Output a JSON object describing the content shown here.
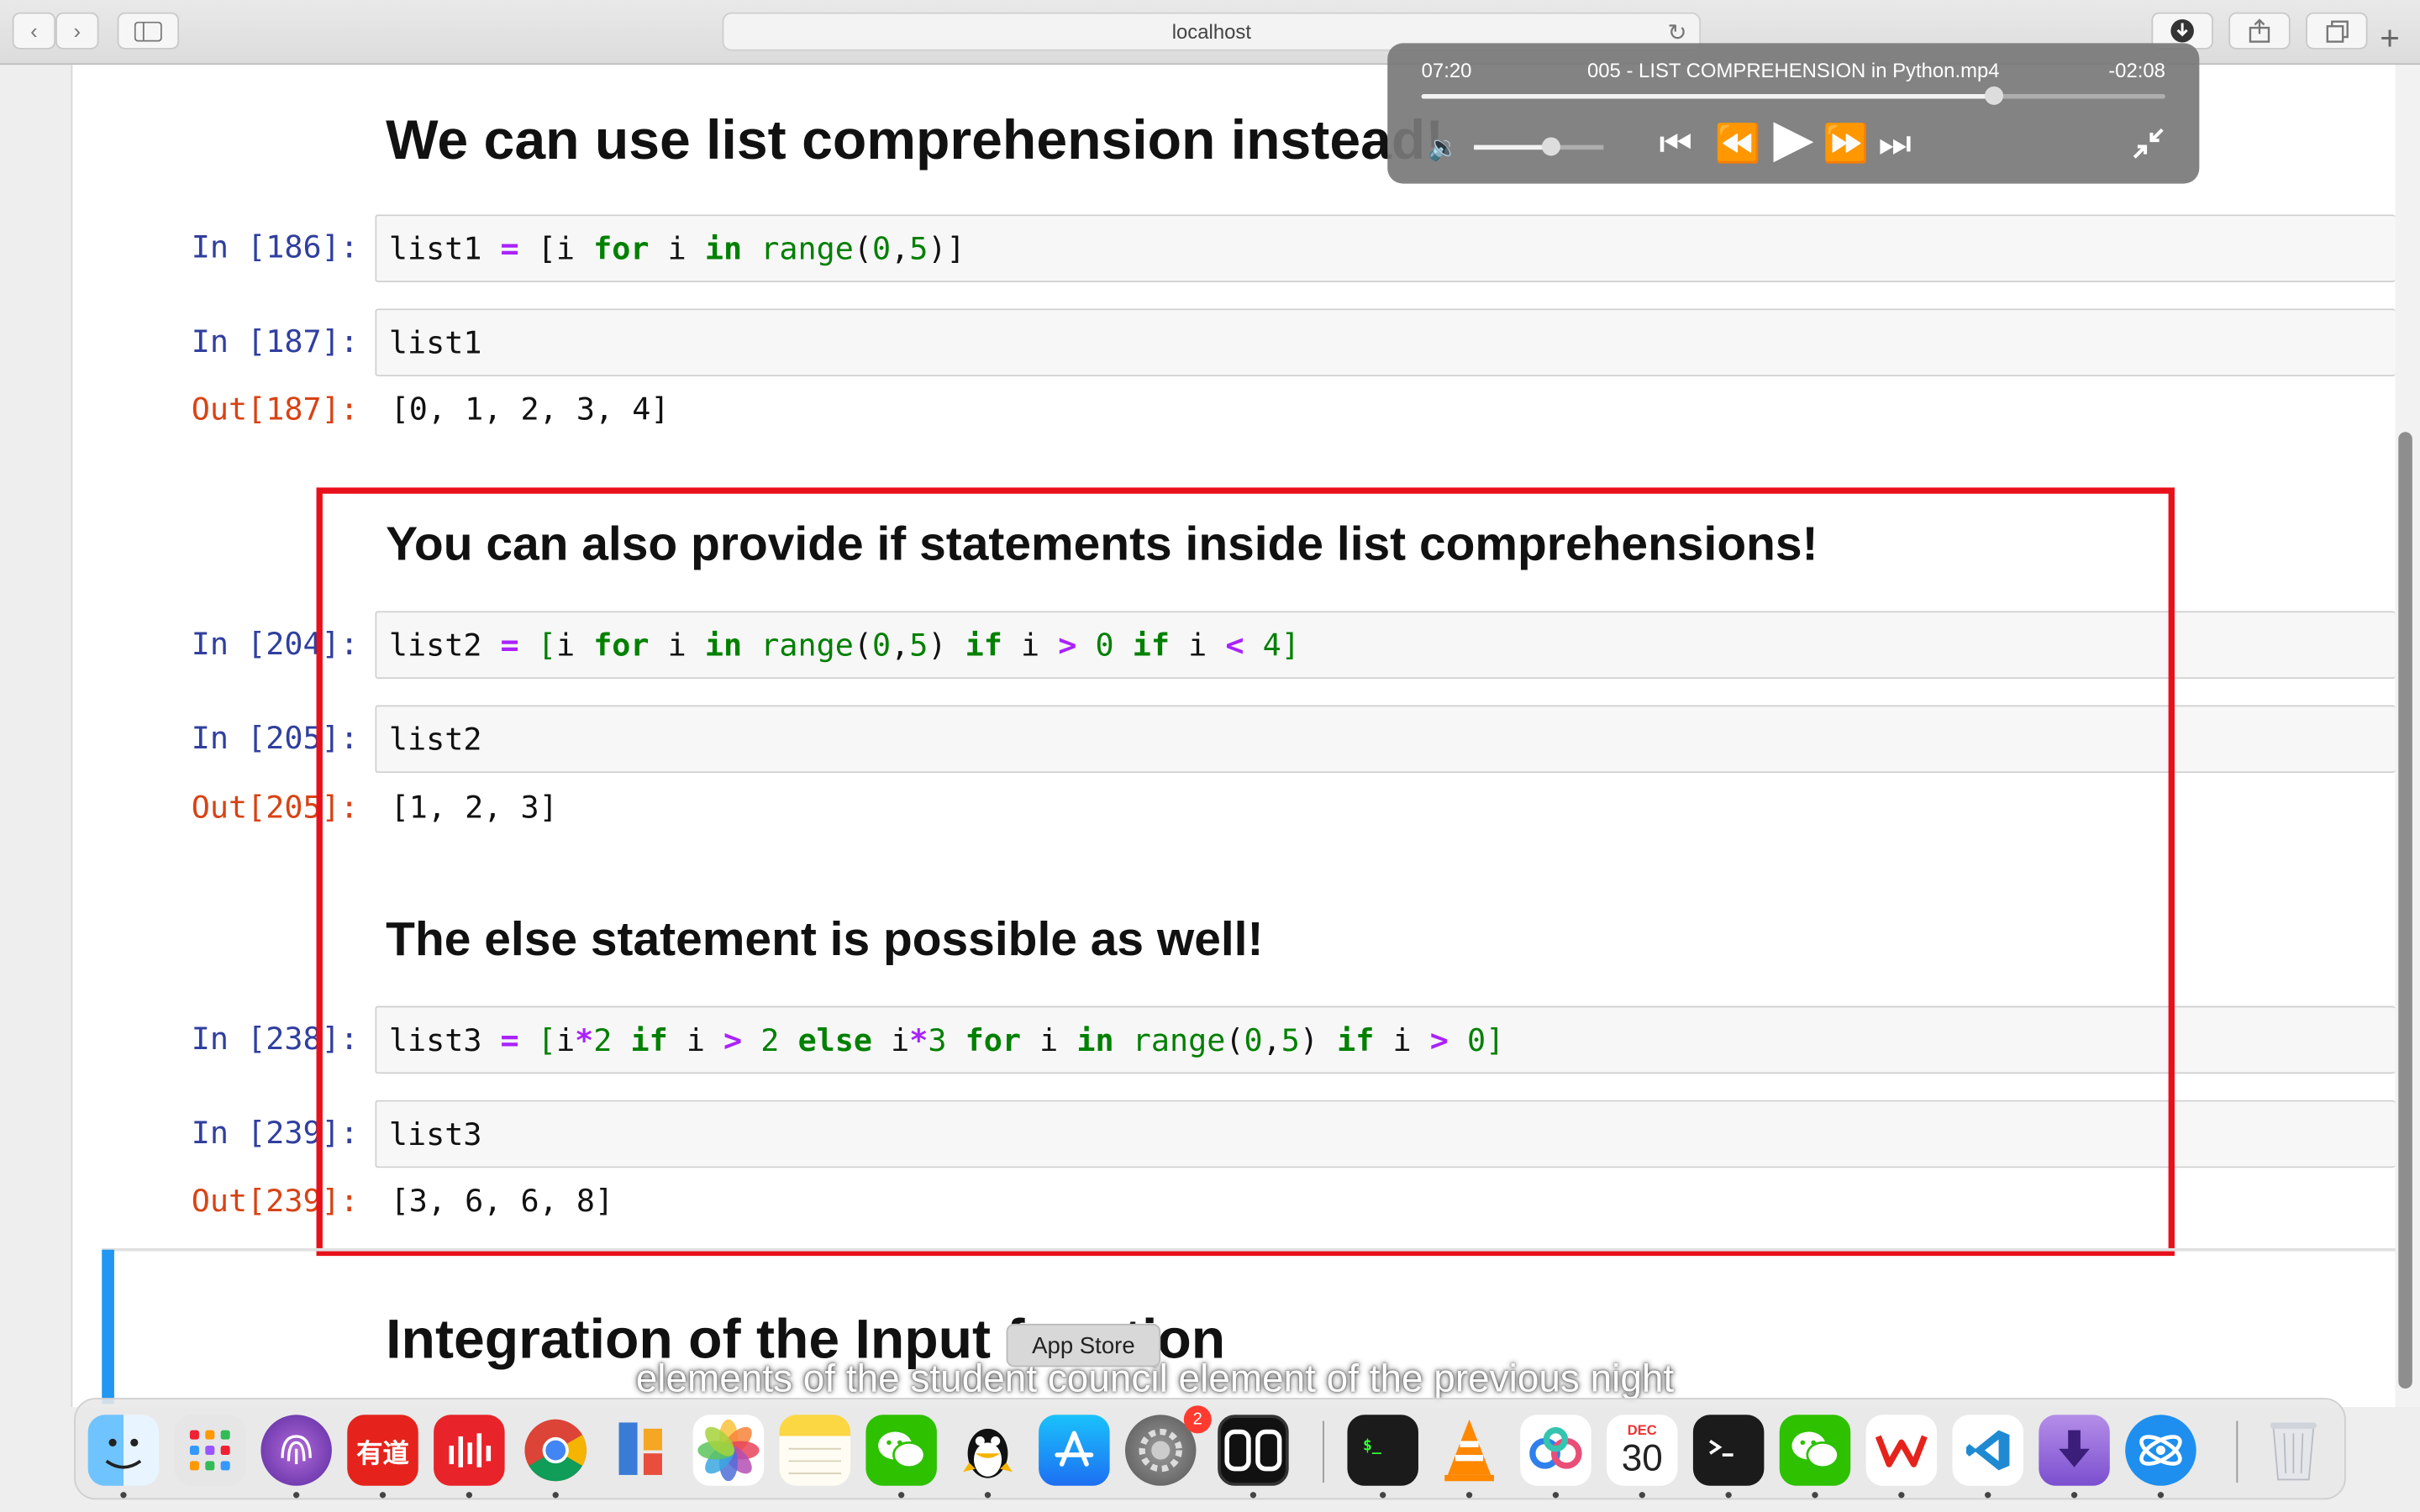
{
  "browser": {
    "address": "localhost",
    "back_icon": "chevron-left-icon",
    "forward_icon": "chevron-right-icon",
    "sidebar_icon": "sidebar-icon",
    "reload_icon": "reload-icon",
    "new_tab_label": "+"
  },
  "notebook": {
    "headings": {
      "h1": "We can use list comprehension instead!",
      "h2": "You can also provide if statements inside list comprehensions!",
      "h3": "The else statement is possible as well!",
      "h4": "Integration of the Input function"
    },
    "prompts": {
      "p186": "In [186]:",
      "p187": "In [187]:",
      "o187": "Out[187]:",
      "p204": "In [204]:",
      "p205": "In [205]:",
      "o205": "Out[205]:",
      "p238": "In [238]:",
      "p239": "In [239]:",
      "o239": "Out[239]:"
    },
    "cells": {
      "c187": "list1",
      "c205": "list2",
      "c239": "list3"
    },
    "outputs": {
      "o187": "[0, 1, 2, 3, 4]",
      "o205": "[1, 2, 3]",
      "o239": "[3, 6, 6, 8]"
    }
  },
  "player": {
    "elapsed": "07:20",
    "title": "005 - LIST COMPREHENSION in Python.mp4",
    "remaining": "-02:08",
    "progress_fraction": 0.77,
    "volume_fraction": 0.6
  },
  "subtitle": "elements of the student council element of the previous night",
  "tooltip": "App Store",
  "dock": {
    "settings_badge": "2",
    "calendar_month": "DEC",
    "calendar_day": "30"
  }
}
